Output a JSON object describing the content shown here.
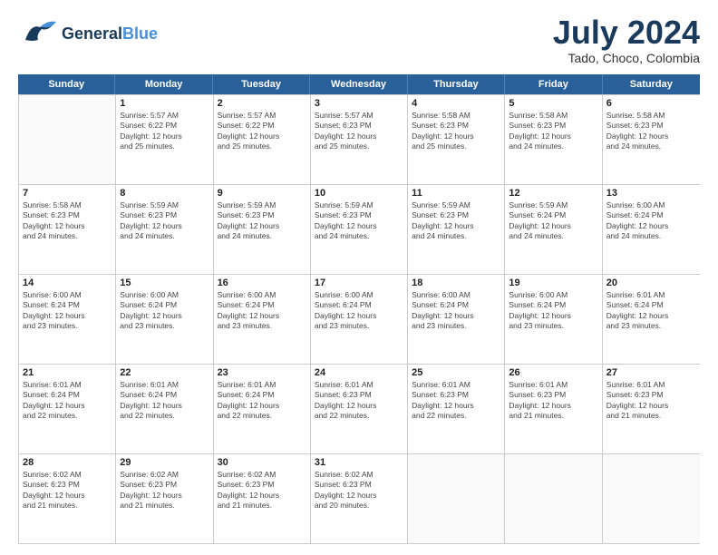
{
  "header": {
    "logo_general": "General",
    "logo_blue": "Blue",
    "month_year": "July 2024",
    "location": "Tado, Choco, Colombia"
  },
  "calendar": {
    "days_of_week": [
      "Sunday",
      "Monday",
      "Tuesday",
      "Wednesday",
      "Thursday",
      "Friday",
      "Saturday"
    ],
    "weeks": [
      [
        {
          "day": "",
          "empty": true
        },
        {
          "day": "1",
          "sunrise": "Sunrise: 5:57 AM",
          "sunset": "Sunset: 6:22 PM",
          "daylight": "Daylight: 12 hours and 25 minutes."
        },
        {
          "day": "2",
          "sunrise": "Sunrise: 5:57 AM",
          "sunset": "Sunset: 6:22 PM",
          "daylight": "Daylight: 12 hours and 25 minutes."
        },
        {
          "day": "3",
          "sunrise": "Sunrise: 5:57 AM",
          "sunset": "Sunset: 6:23 PM",
          "daylight": "Daylight: 12 hours and 25 minutes."
        },
        {
          "day": "4",
          "sunrise": "Sunrise: 5:58 AM",
          "sunset": "Sunset: 6:23 PM",
          "daylight": "Daylight: 12 hours and 25 minutes."
        },
        {
          "day": "5",
          "sunrise": "Sunrise: 5:58 AM",
          "sunset": "Sunset: 6:23 PM",
          "daylight": "Daylight: 12 hours and 24 minutes."
        },
        {
          "day": "6",
          "sunrise": "Sunrise: 5:58 AM",
          "sunset": "Sunset: 6:23 PM",
          "daylight": "Daylight: 12 hours and 24 minutes."
        }
      ],
      [
        {
          "day": "7",
          "sunrise": "Sunrise: 5:58 AM",
          "sunset": "Sunset: 6:23 PM",
          "daylight": "Daylight: 12 hours and 24 minutes."
        },
        {
          "day": "8",
          "sunrise": "Sunrise: 5:59 AM",
          "sunset": "Sunset: 6:23 PM",
          "daylight": "Daylight: 12 hours and 24 minutes."
        },
        {
          "day": "9",
          "sunrise": "Sunrise: 5:59 AM",
          "sunset": "Sunset: 6:23 PM",
          "daylight": "Daylight: 12 hours and 24 minutes."
        },
        {
          "day": "10",
          "sunrise": "Sunrise: 5:59 AM",
          "sunset": "Sunset: 6:23 PM",
          "daylight": "Daylight: 12 hours and 24 minutes."
        },
        {
          "day": "11",
          "sunrise": "Sunrise: 5:59 AM",
          "sunset": "Sunset: 6:23 PM",
          "daylight": "Daylight: 12 hours and 24 minutes."
        },
        {
          "day": "12",
          "sunrise": "Sunrise: 5:59 AM",
          "sunset": "Sunset: 6:24 PM",
          "daylight": "Daylight: 12 hours and 24 minutes."
        },
        {
          "day": "13",
          "sunrise": "Sunrise: 6:00 AM",
          "sunset": "Sunset: 6:24 PM",
          "daylight": "Daylight: 12 hours and 24 minutes."
        }
      ],
      [
        {
          "day": "14",
          "sunrise": "Sunrise: 6:00 AM",
          "sunset": "Sunset: 6:24 PM",
          "daylight": "Daylight: 12 hours and 23 minutes."
        },
        {
          "day": "15",
          "sunrise": "Sunrise: 6:00 AM",
          "sunset": "Sunset: 6:24 PM",
          "daylight": "Daylight: 12 hours and 23 minutes."
        },
        {
          "day": "16",
          "sunrise": "Sunrise: 6:00 AM",
          "sunset": "Sunset: 6:24 PM",
          "daylight": "Daylight: 12 hours and 23 minutes."
        },
        {
          "day": "17",
          "sunrise": "Sunrise: 6:00 AM",
          "sunset": "Sunset: 6:24 PM",
          "daylight": "Daylight: 12 hours and 23 minutes."
        },
        {
          "day": "18",
          "sunrise": "Sunrise: 6:00 AM",
          "sunset": "Sunset: 6:24 PM",
          "daylight": "Daylight: 12 hours and 23 minutes."
        },
        {
          "day": "19",
          "sunrise": "Sunrise: 6:00 AM",
          "sunset": "Sunset: 6:24 PM",
          "daylight": "Daylight: 12 hours and 23 minutes."
        },
        {
          "day": "20",
          "sunrise": "Sunrise: 6:01 AM",
          "sunset": "Sunset: 6:24 PM",
          "daylight": "Daylight: 12 hours and 23 minutes."
        }
      ],
      [
        {
          "day": "21",
          "sunrise": "Sunrise: 6:01 AM",
          "sunset": "Sunset: 6:24 PM",
          "daylight": "Daylight: 12 hours and 22 minutes."
        },
        {
          "day": "22",
          "sunrise": "Sunrise: 6:01 AM",
          "sunset": "Sunset: 6:24 PM",
          "daylight": "Daylight: 12 hours and 22 minutes."
        },
        {
          "day": "23",
          "sunrise": "Sunrise: 6:01 AM",
          "sunset": "Sunset: 6:24 PM",
          "daylight": "Daylight: 12 hours and 22 minutes."
        },
        {
          "day": "24",
          "sunrise": "Sunrise: 6:01 AM",
          "sunset": "Sunset: 6:23 PM",
          "daylight": "Daylight: 12 hours and 22 minutes."
        },
        {
          "day": "25",
          "sunrise": "Sunrise: 6:01 AM",
          "sunset": "Sunset: 6:23 PM",
          "daylight": "Daylight: 12 hours and 22 minutes."
        },
        {
          "day": "26",
          "sunrise": "Sunrise: 6:01 AM",
          "sunset": "Sunset: 6:23 PM",
          "daylight": "Daylight: 12 hours and 21 minutes."
        },
        {
          "day": "27",
          "sunrise": "Sunrise: 6:01 AM",
          "sunset": "Sunset: 6:23 PM",
          "daylight": "Daylight: 12 hours and 21 minutes."
        }
      ],
      [
        {
          "day": "28",
          "sunrise": "Sunrise: 6:02 AM",
          "sunset": "Sunset: 6:23 PM",
          "daylight": "Daylight: 12 hours and 21 minutes."
        },
        {
          "day": "29",
          "sunrise": "Sunrise: 6:02 AM",
          "sunset": "Sunset: 6:23 PM",
          "daylight": "Daylight: 12 hours and 21 minutes."
        },
        {
          "day": "30",
          "sunrise": "Sunrise: 6:02 AM",
          "sunset": "Sunset: 6:23 PM",
          "daylight": "Daylight: 12 hours and 21 minutes."
        },
        {
          "day": "31",
          "sunrise": "Sunrise: 6:02 AM",
          "sunset": "Sunset: 6:23 PM",
          "daylight": "Daylight: 12 hours and 20 minutes."
        },
        {
          "day": "",
          "empty": true
        },
        {
          "day": "",
          "empty": true
        },
        {
          "day": "",
          "empty": true
        }
      ]
    ]
  }
}
